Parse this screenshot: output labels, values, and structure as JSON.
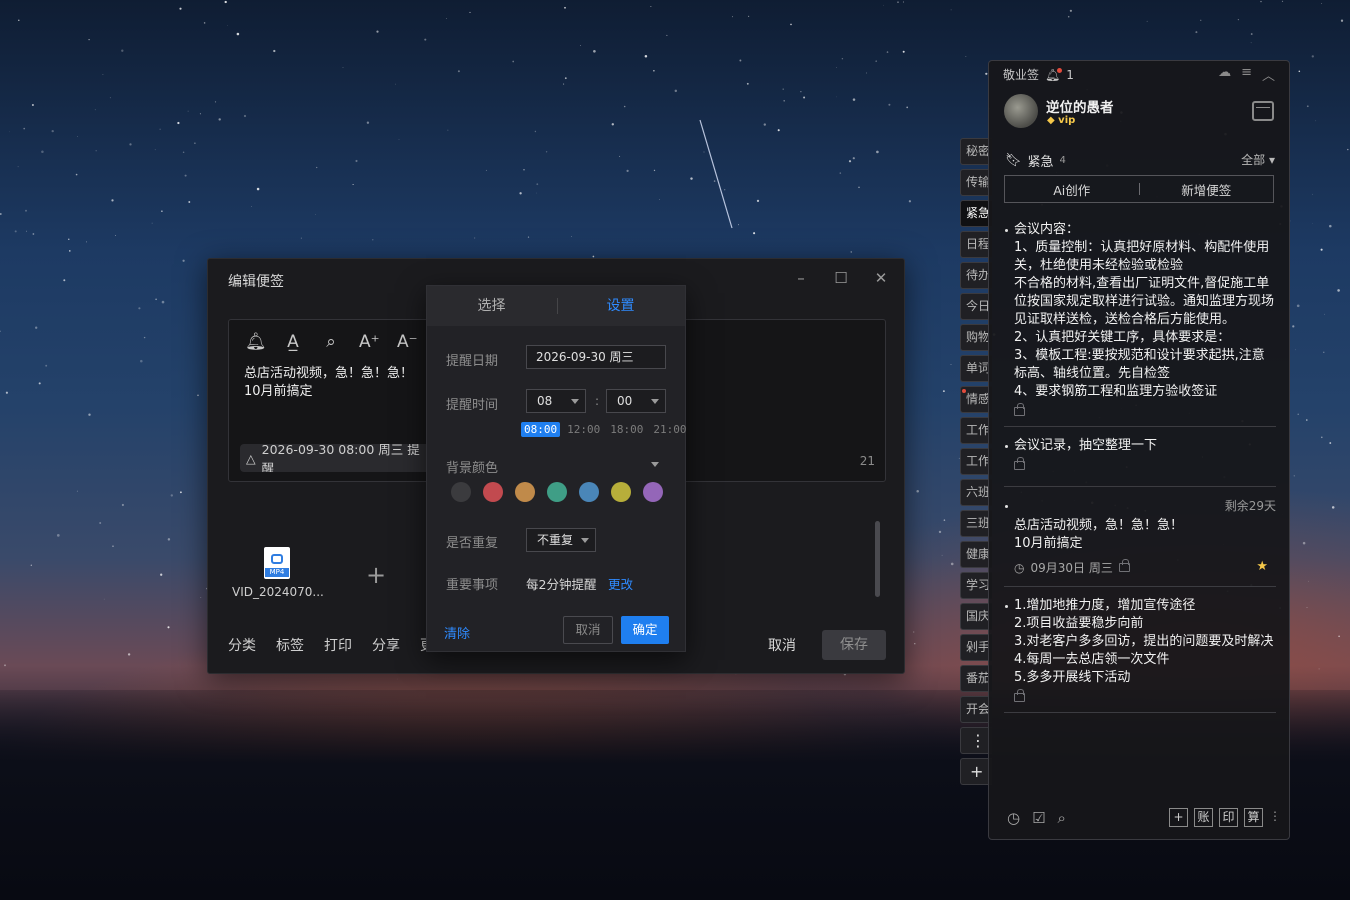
{
  "editor": {
    "title": "编辑便签",
    "note_text": "总店活动视频，急！急！急！\n10月前搞定",
    "reminder_chip": "2026-09-30 08:00 周三 提醒",
    "char_count": "21",
    "attachment": {
      "name": "VID_2024070...",
      "type": "MP4"
    },
    "bottom_actions": [
      "分类",
      "标签",
      "打印",
      "分享",
      "更"
    ],
    "cancel_label": "取消",
    "save_label": "保存"
  },
  "reminder_popup": {
    "tab_select": "选择",
    "tab_settings": "设置",
    "date_label": "提醒日期",
    "date_value": "2026-09-30  周三",
    "time_label": "提醒时间",
    "hour_value": "08",
    "minute_value": "00",
    "time_separator": ":",
    "quick_times": [
      "08:00",
      "12:00",
      "18:00",
      "21:00"
    ],
    "bg_color_label": "背景颜色",
    "colors": [
      "#3b3b3e",
      "#c24a4f",
      "#c08a4a",
      "#3f9e86",
      "#4a86b8",
      "#b7ae3a",
      "#9466b8"
    ],
    "repeat_label": "是否重复",
    "repeat_value": "不重复",
    "important_label": "重要事项",
    "important_value": "每2分钟提醒",
    "change_label": "更改",
    "clear_label": "清除",
    "cancel_label": "取消",
    "ok_label": "确定"
  },
  "category_tabs": [
    "秘密",
    "传输",
    "紧急",
    "日程",
    "待办",
    "今日",
    "购物",
    "单词",
    "情感",
    "工作",
    "工作",
    "六班",
    "三班",
    "健康",
    "学习",
    "国庆",
    "剁手",
    "番茄",
    "开会"
  ],
  "panel": {
    "app_name": "敬业签",
    "notification_count": "1",
    "user_name": "逆位的愚者",
    "vip_label": "vip",
    "group_name": "紧急",
    "group_count": "4",
    "filter_label": "全部",
    "ai_create_label": "Ai创作",
    "new_note_label": "新增便签",
    "notes": [
      {
        "text": "会议内容：\n1、质量控制：认真把好原材料、构配件使用关，杜绝使用未经检验或检验\n不合格的材料,查看出厂证明文件,督促施工单位按国家规定取样进行试验。通知监理方现场见证取样送检，送检合格后方能使用。\n2、认真把好关键工序，具体要求是：\n3、模板工程:要按规范和设计要求起拱,注意标高、轴线位置。先自检签\n4、要求钢筋工程和监理方验收签证"
      },
      {
        "text": "会议记录，抽空整理一下"
      },
      {
        "remain": "剩余29天",
        "text": "总店活动视频，急！急！急！\n10月前搞定",
        "due": "09月30日 周三"
      },
      {
        "text": "1.增加地推力度，增加宣传途径\n2.项目收益要稳步向前\n3.对老客户多多回访，提出的问题要及时解决\n4.每周一去总店领一次文件\n5.多多开展线下活动"
      }
    ],
    "bottom_tools": [
      "账",
      "印",
      "算"
    ]
  }
}
